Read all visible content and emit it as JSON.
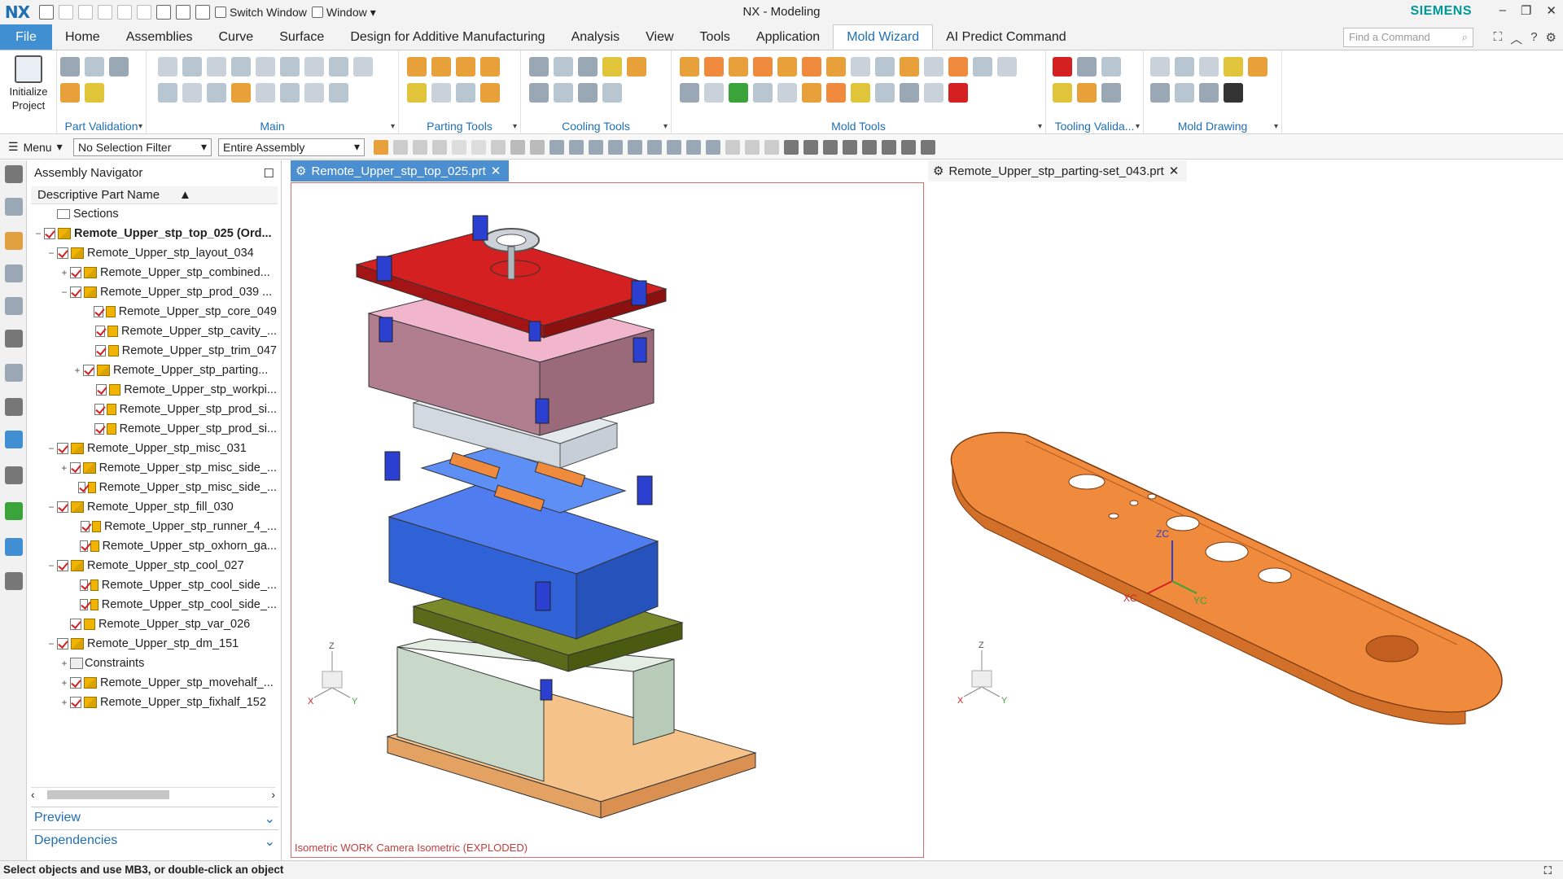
{
  "titlebar": {
    "logo": "NX",
    "switch_window": "Switch Window",
    "window_menu": "Window",
    "title": "NX - Modeling",
    "brand": "SIEMENS"
  },
  "tabs": {
    "file": "File",
    "items": [
      "Home",
      "Assemblies",
      "Curve",
      "Surface",
      "Design for Additive Manufacturing",
      "Analysis",
      "View",
      "Tools",
      "Application",
      "Mold Wizard",
      "AI Predict Command"
    ],
    "active": "Mold Wizard",
    "find_placeholder": "Find a Command"
  },
  "ribbon": {
    "initialize_project": "Initialize Project",
    "groups": [
      "Part Validation",
      "Main",
      "Parting Tools",
      "Cooling Tools",
      "Mold Tools",
      "Tooling Valida...",
      "Mold Drawing"
    ]
  },
  "selection_bar": {
    "menu": "Menu",
    "filter": "No Selection Filter",
    "scope": "Entire Assembly"
  },
  "navigator": {
    "title": "Assembly Navigator",
    "column": "Descriptive Part Name",
    "rows": [
      {
        "label": "Sections",
        "type": "folder"
      },
      {
        "label": "Remote_Upper_stp_top_025 (Ord...",
        "type": "asm",
        "toggle": "−"
      },
      {
        "label": "Remote_Upper_stp_layout_034",
        "type": "asm",
        "toggle": "−"
      },
      {
        "label": "Remote_Upper_stp_combined...",
        "type": "asm",
        "toggle": "+"
      },
      {
        "label": "Remote_Upper_stp_prod_039 ...",
        "type": "asm",
        "toggle": "−"
      },
      {
        "label": "Remote_Upper_stp_core_049",
        "type": "part",
        "toggle": ""
      },
      {
        "label": "Remote_Upper_stp_cavity_...",
        "type": "part",
        "toggle": ""
      },
      {
        "label": "Remote_Upper_stp_trim_047",
        "type": "part",
        "toggle": ""
      },
      {
        "label": "Remote_Upper_stp_parting...",
        "type": "asm",
        "toggle": "+"
      },
      {
        "label": "Remote_Upper_stp_workpi...",
        "type": "part",
        "toggle": ""
      },
      {
        "label": "Remote_Upper_stp_prod_si...",
        "type": "part",
        "toggle": ""
      },
      {
        "label": "Remote_Upper_stp_prod_si...",
        "type": "part",
        "toggle": ""
      },
      {
        "label": "Remote_Upper_stp_misc_031",
        "type": "asm",
        "toggle": "−"
      },
      {
        "label": "Remote_Upper_stp_misc_side_...",
        "type": "asm",
        "toggle": "+"
      },
      {
        "label": "Remote_Upper_stp_misc_side_...",
        "type": "part",
        "toggle": ""
      },
      {
        "label": "Remote_Upper_stp_fill_030",
        "type": "asm",
        "toggle": "−"
      },
      {
        "label": "Remote_Upper_stp_runner_4_...",
        "type": "part",
        "toggle": ""
      },
      {
        "label": "Remote_Upper_stp_oxhorn_ga...",
        "type": "part",
        "toggle": ""
      },
      {
        "label": "Remote_Upper_stp_cool_027",
        "type": "asm",
        "toggle": "−"
      },
      {
        "label": "Remote_Upper_stp_cool_side_...",
        "type": "part",
        "toggle": ""
      },
      {
        "label": "Remote_Upper_stp_cool_side_...",
        "type": "part",
        "toggle": ""
      },
      {
        "label": "Remote_Upper_stp_var_026",
        "type": "part",
        "toggle": ""
      },
      {
        "label": "Remote_Upper_stp_dm_151",
        "type": "asm",
        "toggle": "−"
      },
      {
        "label": "Constraints",
        "type": "constraint",
        "toggle": "+"
      },
      {
        "label": "Remote_Upper_stp_movehalf_...",
        "type": "asm",
        "toggle": "+"
      },
      {
        "label": "Remote_Upper_stp_fixhalf_152",
        "type": "asm",
        "toggle": "+"
      }
    ],
    "preview": "Preview",
    "dependencies": "Dependencies"
  },
  "viewports": {
    "left_tab": "Remote_Upper_stp_top_025.prt",
    "right_tab": "Remote_Upper_stp_parting-set_043.prt",
    "left_caption": "Isometric WORK Camera Isometric (EXPLODED)",
    "axis_x": "X",
    "axis_y": "Y",
    "axis_z": "Z",
    "zc": "ZC",
    "xc": "XC",
    "yc": "YC"
  },
  "status": {
    "message": "Select objects and use MB3, or double-click an object"
  },
  "colors": {
    "accent": "#1f6fb3",
    "file_tab": "#3f8fd2",
    "brand": "#009999",
    "plate_red": "#d42020",
    "plate_blue": "#2f62d6",
    "part_orange": "#f08a3c"
  }
}
